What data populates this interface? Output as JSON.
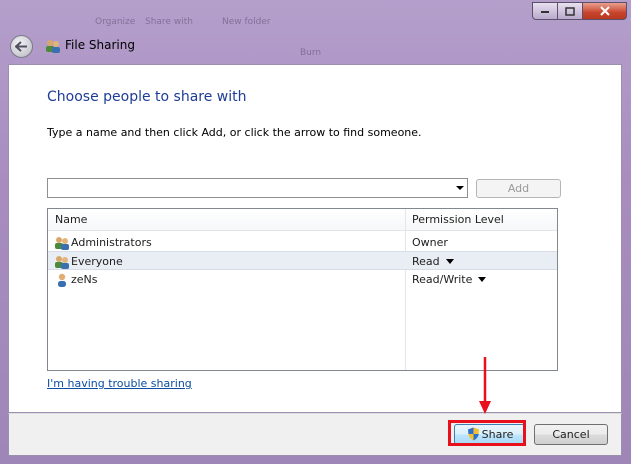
{
  "window": {
    "title": "File Sharing",
    "background_hints": [
      "Organize",
      "Share with",
      "Burn",
      "New folder"
    ],
    "controls": [
      "minimize",
      "maximize",
      "close"
    ]
  },
  "page": {
    "heading": "Choose people to share with",
    "instruction": "Type a name and then click Add, or click the arrow to find someone."
  },
  "name_input": {
    "value": "",
    "placeholder": ""
  },
  "add_button": {
    "label": "Add",
    "enabled": false
  },
  "table": {
    "columns": [
      "Name",
      "Permission Level"
    ],
    "rows": [
      {
        "name": "Administrators",
        "permission": "Owner",
        "icon": "group-icon",
        "has_dropdown": false
      },
      {
        "name": "Everyone",
        "permission": "Read",
        "icon": "group-icon",
        "has_dropdown": true,
        "selected": true
      },
      {
        "name": "zeNs",
        "permission": "Read/Write",
        "icon": "user-icon",
        "has_dropdown": true
      }
    ]
  },
  "help_link": "I'm having trouble sharing",
  "buttons": {
    "share": "Share",
    "cancel": "Cancel"
  },
  "colors": {
    "heading": "#1e3c96",
    "link": "#0b4ea2",
    "highlight": "#e8101a"
  }
}
